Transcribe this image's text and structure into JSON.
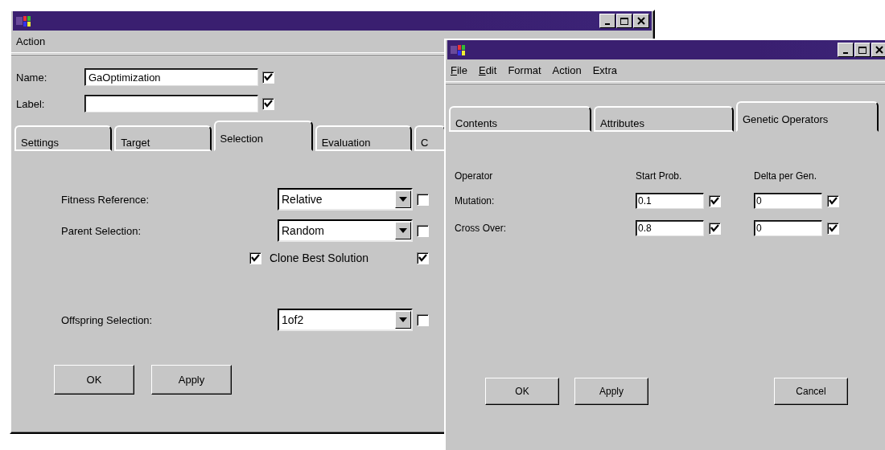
{
  "windows": [
    {
      "kind": "dialog",
      "menu": [
        {
          "label": "Action",
          "mnemonic": false
        }
      ],
      "fields": [
        {
          "label": "Name:",
          "value": "GaOptimization",
          "checked": true
        },
        {
          "label": "Label:",
          "checked": true
        }
      ],
      "tabs": [
        {
          "label": "Settings",
          "selected": false
        },
        {
          "label": "Target",
          "selected": false
        },
        {
          "label": "Selection",
          "selected": true
        },
        {
          "label": "Evaluation",
          "selected": false
        },
        {
          "label": "C",
          "selected": false
        }
      ],
      "settings": [
        {
          "kind": "dropdown",
          "label": "Fitness Reference:",
          "value": "Relative",
          "checked": false
        },
        {
          "kind": "dropdown",
          "label": "Parent Selection:",
          "value": "Random",
          "checked": false
        },
        {
          "kind": "check",
          "label": "Clone Best Solution",
          "on": true,
          "checked": true
        },
        {
          "kind": "dropdown",
          "label": "Offspring Selection:",
          "value": "1of2",
          "checked": false
        }
      ],
      "buttons": [
        "OK",
        "Apply"
      ]
    },
    {
      "kind": "grid",
      "menu": [
        {
          "label": "File",
          "mnemonic": true
        },
        {
          "label": "Edit",
          "mnemonic": true
        },
        {
          "label": "Format",
          "mnemonic": false
        },
        {
          "label": "Action",
          "mnemonic": false
        },
        {
          "label": "Extra",
          "mnemonic": false
        }
      ],
      "tabs": [
        {
          "label": "Contents",
          "selected": false
        },
        {
          "label": "Attributes",
          "selected": false
        },
        {
          "label": "Genetic Operators",
          "selected": true
        }
      ],
      "columns": [
        "Operator",
        "Start Prob.",
        "Delta per Gen."
      ],
      "rows": [
        {
          "label": "Mutation:",
          "start": {
            "value": "0.1",
            "checked": true
          },
          "delta": {
            "value": "0",
            "checked": true
          }
        },
        {
          "label": "Cross Over:",
          "start": {
            "value": "0.8",
            "checked": true
          },
          "delta": {
            "value": "0",
            "checked": true
          }
        }
      ],
      "buttons": [
        "OK",
        "Apply",
        "Cancel"
      ]
    }
  ]
}
